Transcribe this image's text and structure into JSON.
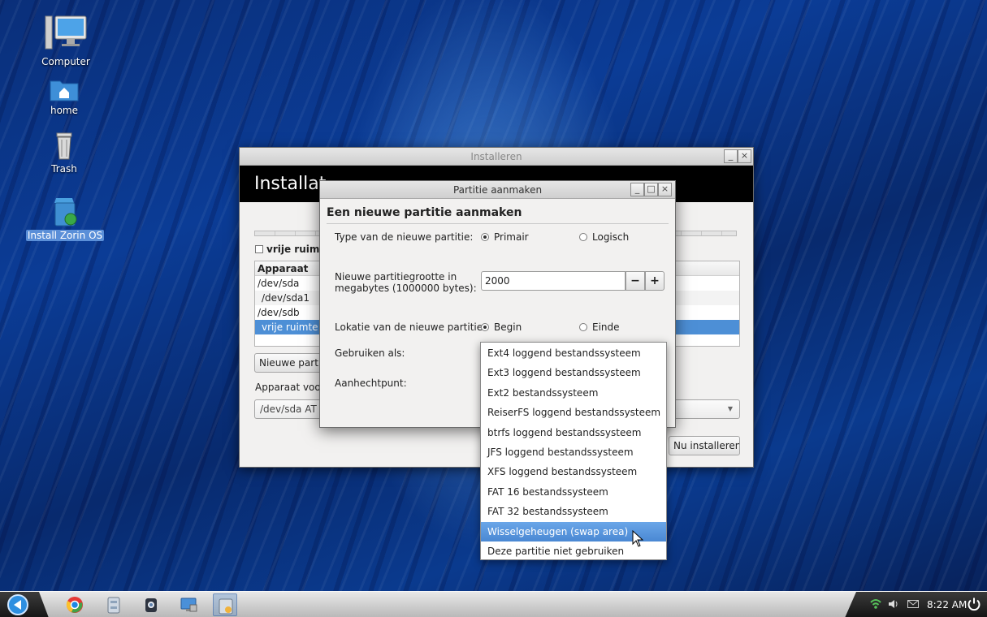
{
  "desktop": {
    "icons": [
      {
        "label": "Computer"
      },
      {
        "label": "home"
      },
      {
        "label": "Trash"
      },
      {
        "label": "Install Zorin OS"
      }
    ]
  },
  "installer": {
    "window_title": "Installeren",
    "header_title": "Installat",
    "free_space_label": "vrije ruimte",
    "table": {
      "header": "Apparaat",
      "rows": [
        "/dev/sda",
        "/dev/sda1",
        "/dev/sdb",
        "vrije ruimte"
      ],
      "selected_index": 3
    },
    "new_partition_button": "Nieuwe partit",
    "bootloader_label": "Apparaat voor",
    "bootloader_value": "/dev/sda   AT",
    "install_button": "Nu installeren"
  },
  "dialog": {
    "title": "Partitie aanmaken",
    "heading": "Een nieuwe partitie aanmaken",
    "type_label": "Type van de nieuwe partitie:",
    "type_primary": "Primair",
    "type_logical": "Logisch",
    "size_label_line1": "Nieuwe partitiegrootte in",
    "size_label_line2": "megabytes (1000000 bytes):",
    "size_value": "2000",
    "minus": "−",
    "plus": "+",
    "location_label": "Lokatie van de nieuwe partitie",
    "location_begin": "Begin",
    "location_end": "Einde",
    "use_as_label": "Gebruiken als:",
    "mount_label": "Aanhechtpunt:"
  },
  "dropdown": {
    "items": [
      "Ext4 loggend bestandssysteem",
      "Ext3 loggend bestandssysteem",
      "Ext2 bestandssysteem",
      "ReiserFS loggend bestandssysteem",
      "btrfs loggend bestandssysteem",
      "JFS loggend bestandssysteem",
      "XFS loggend bestandssysteem",
      "FAT 16 bestandssysteem",
      "FAT 32 bestandssysteem",
      "Wisselgeheugen (swap area)",
      "Deze partitie niet gebruiken"
    ],
    "highlighted_index": 9
  },
  "taskbar": {
    "apps": [
      "start-menu",
      "chrome",
      "files",
      "webcam",
      "remote-desktop",
      "installer"
    ],
    "clock": "8:22 AM"
  },
  "colors": {
    "selection": "#4d8fd6",
    "desktop_blue": "#0b3c96"
  }
}
